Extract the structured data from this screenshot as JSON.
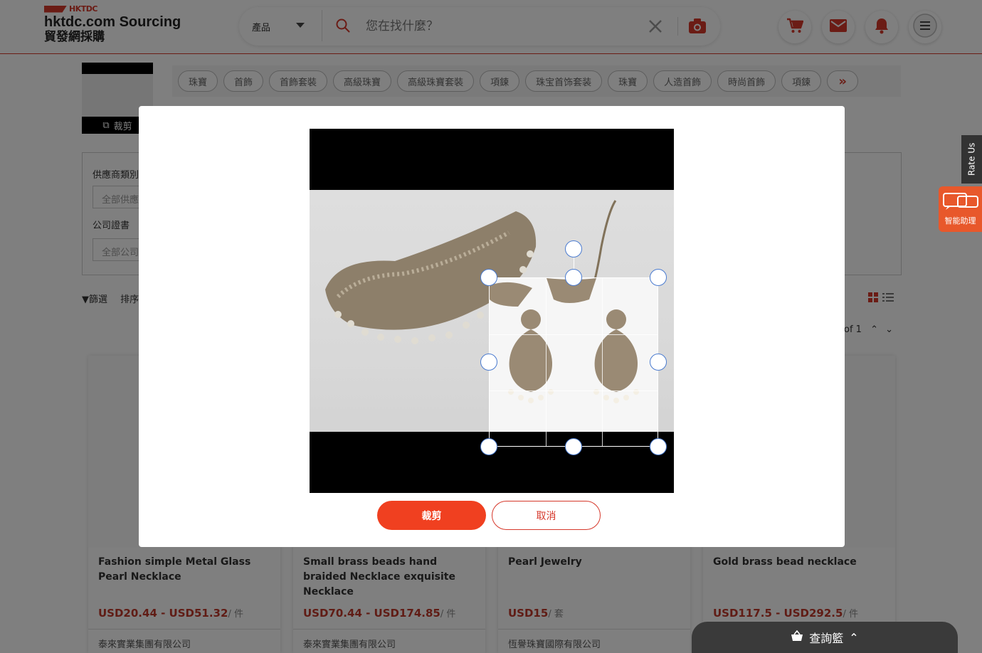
{
  "header": {
    "logo_mark": "HKTDC",
    "logo_title": "hktdc.com Sourcing",
    "logo_subtitle": "貿發網採購",
    "search_category": "產品",
    "search_placeholder": "您在找什麼？"
  },
  "thumbnail": {
    "crop_label": "裁剪"
  },
  "tags": [
    "珠寶",
    "首飾",
    "首飾套裝",
    "高級珠寶",
    "高級珠寶套裝",
    "項鍊",
    "珠宝首饰套装",
    "珠寶",
    "人造首飾",
    "時尚首飾",
    "項鍊"
  ],
  "filters": {
    "supplier_type_label": "供應商類別",
    "supplier_type_value": "全部供應",
    "certificate_label": "公司證書",
    "certificate_value": "全部公司"
  },
  "toolbar": {
    "filter_label": "篩選",
    "sort_label": "排序"
  },
  "pager": {
    "text": "of 1"
  },
  "cards": [
    {
      "title": "Fashion simple Metal Glass Pearl Necklace",
      "price": "USD20.44 - USD51.32",
      "unit": "/ 件",
      "supplier": "泰來實業集團有限公司"
    },
    {
      "title": "Small brass beads hand braided Necklace exquisite Necklace",
      "price": "USD70.44 - USD174.85",
      "unit": "/ 件",
      "supplier": "泰來實業集團有限公司"
    },
    {
      "title": "Pearl Jewelry",
      "price": "USD15",
      "unit": "/ 套",
      "supplier": "恆譽珠寶國際有限公司"
    },
    {
      "title": "Gold brass bead necklace",
      "price": "USD117.5 - USD292.5",
      "unit": "/ 件",
      "supplier": ""
    }
  ],
  "side": {
    "rate_us": "Rate Us",
    "assistant": "智能助理"
  },
  "inquiry": {
    "label": "查詢籃"
  },
  "modal": {
    "crop_button": "裁剪",
    "cancel_button": "取消"
  },
  "colors": {
    "brand": "#d6382b",
    "primary_button": "#f04020"
  }
}
